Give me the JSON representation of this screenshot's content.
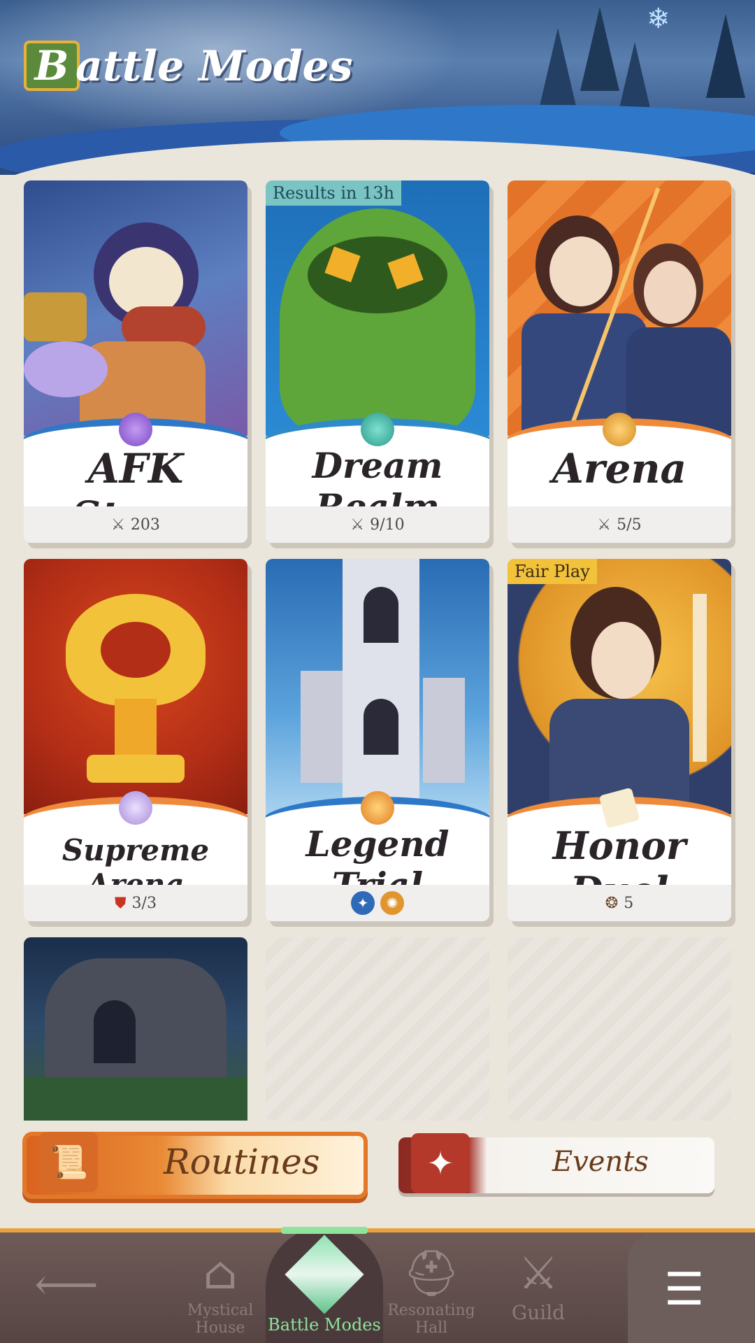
{
  "header": {
    "title_initial": "B",
    "title_rest": "attle Modes"
  },
  "cards": [
    {
      "name": "AFK Stage",
      "tag": "",
      "footer_icon": "swords-icon",
      "footer_text": "203",
      "accent": "#2e78c8",
      "bg": "#3d5ea0"
    },
    {
      "name": "Dream Realm",
      "tag": "Results in 13h",
      "footer_icon": "swords-icon",
      "footer_text": "9/10",
      "accent": "#2e8bc8",
      "bg": "#1f6fb4"
    },
    {
      "name": "Arena",
      "tag": "",
      "footer_icon": "swords-icon",
      "footer_text": "5/5",
      "accent": "#ef8a3a",
      "bg": "#e8782a"
    },
    {
      "name": "Supreme Arena",
      "tag": "",
      "footer_icon": "shield-crest-icon",
      "footer_text": "3/3",
      "accent": "#ef8a3a",
      "bg": "#c0401e"
    },
    {
      "name": "Legend Trial",
      "tag": "",
      "footer_icon": "faction-icons",
      "footer_text": "",
      "accent": "#2e78c8",
      "bg": "#3b86c8"
    },
    {
      "name": "Honor Duel",
      "tag": "Fair Play",
      "footer_icon": "medal-icon",
      "footer_text": "5",
      "accent": "#ef8a3a",
      "bg": "#e0962c"
    }
  ],
  "tabs": {
    "routines": "Routines",
    "events": "Events"
  },
  "nav": {
    "back": "",
    "mystical_house": "Mystical House",
    "battle_modes": "Battle Modes",
    "resonating_hall": "Resonating Hall",
    "guild": "Guild"
  }
}
